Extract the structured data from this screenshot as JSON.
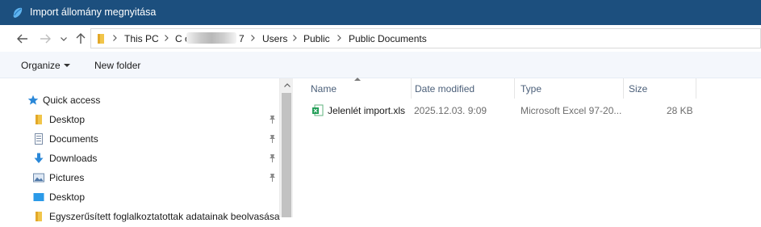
{
  "window": {
    "title": "Import állomány megnyitása"
  },
  "address": {
    "crumbs": [
      "This PC",
      "C on K",
      "7",
      "Users",
      "Public",
      "Public Documents"
    ]
  },
  "toolbar": {
    "organize_label": "Organize",
    "new_folder_label": "New folder"
  },
  "nav": {
    "quick_access": "Quick access",
    "items": [
      {
        "label": "Desktop",
        "icon": "folder-icon",
        "pinned": true
      },
      {
        "label": "Documents",
        "icon": "documents-icon",
        "pinned": true
      },
      {
        "label": "Downloads",
        "icon": "download-icon",
        "pinned": true
      },
      {
        "label": "Pictures",
        "icon": "pictures-icon",
        "pinned": true
      },
      {
        "label": "Desktop",
        "icon": "desktop-icon",
        "pinned": false
      },
      {
        "label": "Egyszerűsített foglalkoztatottak adatainak beolvasása",
        "icon": "folder-icon",
        "pinned": false
      }
    ]
  },
  "filelist": {
    "columns": [
      "Name",
      "Date modified",
      "Type",
      "Size"
    ],
    "rows": [
      {
        "name": "Jelenlét import.xls",
        "date": "2025.12.03. 9:09",
        "type": "Microsoft Excel 97-20...",
        "size": "28 KB"
      }
    ]
  },
  "colors": {
    "titlebar": "#1c4f7e",
    "toolbar": "#f4f7fc",
    "header_text": "#4c607a",
    "excel_green": "#1f9d55"
  }
}
